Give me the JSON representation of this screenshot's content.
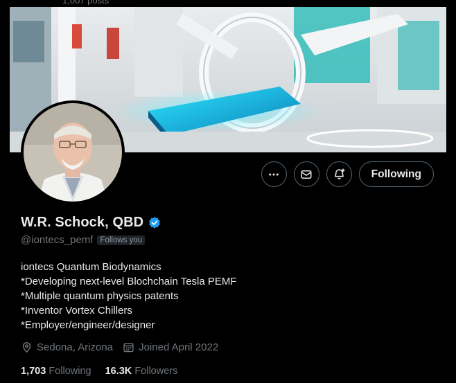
{
  "header": {
    "posts_label": "1,007 posts"
  },
  "banner": {
    "description": "futuristic lab with glowing blue medical bed"
  },
  "profile": {
    "display_name": "W.R. Schock, QBD",
    "verified_icon": "verified-badge-icon",
    "handle": "@iontecs_pemf",
    "follows_you": "Follows you",
    "bio_lines": [
      "iontecs Quantum Biodynamics",
      "*Developing next-level Blochchain Tesla PEMF",
      "*Multiple quantum physics patents",
      "*Inventor Vortex Chillers",
      "*Employer/engineer/designer"
    ],
    "location": "Sedona, Arizona",
    "joined": "Joined April 2022",
    "following_count": "1,703",
    "following_label": "Following",
    "followers_count": "16.3K",
    "followers_label": "Followers"
  },
  "actions": {
    "more_icon": "more-icon",
    "message_icon": "mail-icon",
    "notify_icon": "bell-plus-icon",
    "follow_label": "Following"
  },
  "colors": {
    "background": "#000000",
    "text": "#e7e9ea",
    "muted": "#71767b",
    "border": "#536471",
    "verified": "#1d9bf0"
  }
}
